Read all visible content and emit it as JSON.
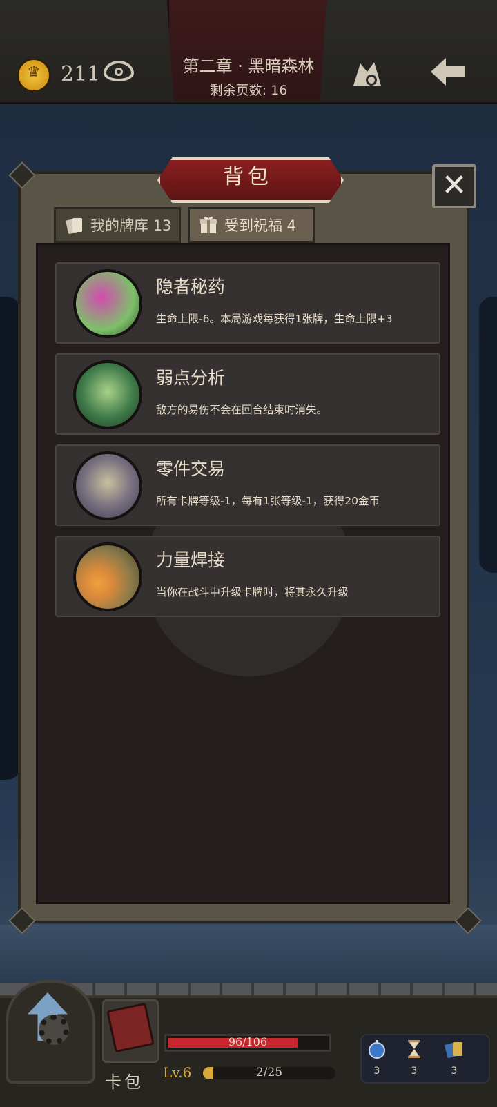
{
  "topbar": {
    "gold": "211",
    "chapter_title": "第二章 · 黑暗森林",
    "pages_remaining": "剩余页数: 16"
  },
  "panel": {
    "title": "背包",
    "close_label": "✕",
    "tabs": [
      {
        "label": "我的牌库 13",
        "icon": "cards-icon",
        "active": false
      },
      {
        "label": "受到祝福 4",
        "icon": "gift-icon",
        "active": true
      }
    ],
    "blessings": [
      {
        "name": "隐者秘药",
        "desc": "生命上限-6。本局游戏每获得1张牌，生命上限+3",
        "portrait_colors": [
          "#d24bb0",
          "#7dc06a"
        ]
      },
      {
        "name": "弱点分析",
        "desc": "敌方的易伤不会在回合结束时消失。",
        "portrait_colors": [
          "#3f7a4a",
          "#a9d18a"
        ]
      },
      {
        "name": "零件交易",
        "desc": "所有卡牌等级-1，每有1张等级-1，获得20金币",
        "portrait_colors": [
          "#c9c0a0",
          "#3a3a52"
        ]
      },
      {
        "name": "力量焊接",
        "desc": "当你在战斗中升级卡牌时，将其永久升级",
        "portrait_colors": [
          "#d98a3a",
          "#6a5a3a"
        ]
      }
    ]
  },
  "bottombar": {
    "cardpack_label": "卡包",
    "hp_text": "96/106",
    "hp_current": 96,
    "hp_max": 106,
    "level_text": "Lv.6",
    "xp_text": "2/25",
    "xp_current": 2,
    "xp_max": 25,
    "items": [
      {
        "icon": "potion-icon",
        "count": "3"
      },
      {
        "icon": "hourglass-icon",
        "count": "3"
      },
      {
        "icon": "cards-icon",
        "count": "3"
      }
    ]
  }
}
